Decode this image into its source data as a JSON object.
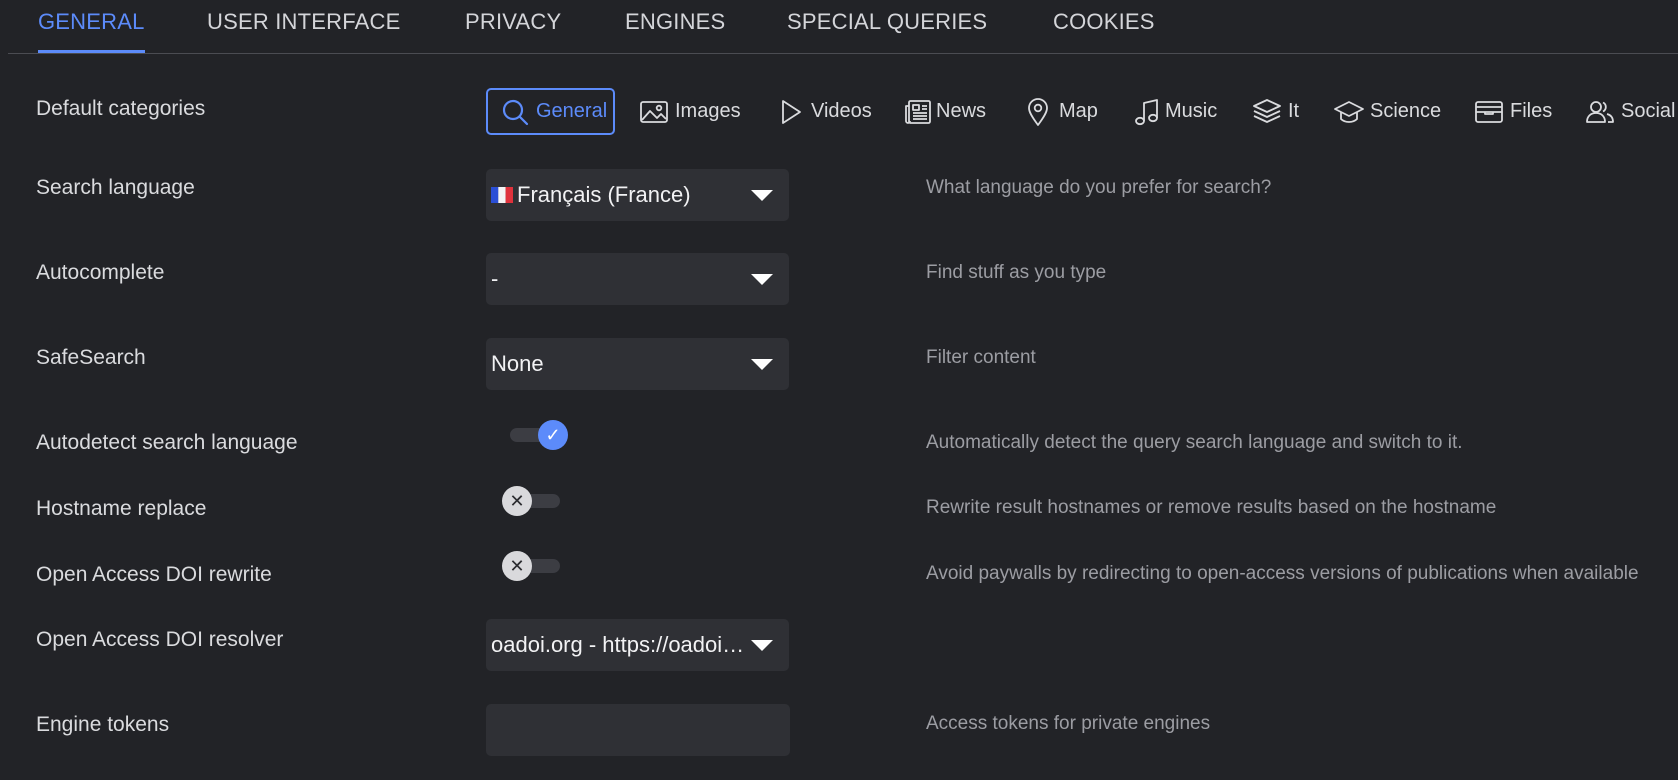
{
  "tabs": [
    {
      "label": "GENERAL",
      "active": true
    },
    {
      "label": "USER INTERFACE",
      "active": false
    },
    {
      "label": "PRIVACY",
      "active": false
    },
    {
      "label": "ENGINES",
      "active": false
    },
    {
      "label": "SPECIAL QUERIES",
      "active": false
    },
    {
      "label": "COOKIES",
      "active": false
    }
  ],
  "default_categories": {
    "label": "Default categories",
    "items": [
      {
        "label": "General",
        "icon": "search-icon",
        "selected": true
      },
      {
        "label": "Images",
        "icon": "image-icon",
        "selected": false
      },
      {
        "label": "Videos",
        "icon": "play-icon",
        "selected": false
      },
      {
        "label": "News",
        "icon": "newspaper-icon",
        "selected": false
      },
      {
        "label": "Map",
        "icon": "map-pin-icon",
        "selected": false
      },
      {
        "label": "Music",
        "icon": "music-note-icon",
        "selected": false
      },
      {
        "label": "It",
        "icon": "layers-icon",
        "selected": false
      },
      {
        "label": "Science",
        "icon": "graduation-cap-icon",
        "selected": false
      },
      {
        "label": "Files",
        "icon": "archive-tray-icon",
        "selected": false
      },
      {
        "label": "Social",
        "icon": "people-icon",
        "selected": false
      }
    ]
  },
  "search_language": {
    "label": "Search language",
    "value": "Français (France)",
    "flag": "french-flag-icon",
    "description": "What language do you prefer for search?"
  },
  "autocomplete": {
    "label": "Autocomplete",
    "value": "-",
    "description": "Find stuff as you type"
  },
  "safesearch": {
    "label": "SafeSearch",
    "value": "None",
    "description": "Filter content"
  },
  "autodetect_language": {
    "label": "Autodetect search language",
    "enabled": true,
    "knob_symbol": "✓",
    "description": "Automatically detect the query search language and switch to it."
  },
  "hostname_replace": {
    "label": "Hostname replace",
    "enabled": false,
    "knob_symbol": "✕",
    "description": "Rewrite result hostnames or remove results based on the hostname"
  },
  "oa_doi_rewrite": {
    "label": "Open Access DOI rewrite",
    "enabled": false,
    "knob_symbol": "✕",
    "description": "Avoid paywalls by redirecting to open-access versions of publications when available"
  },
  "oa_doi_resolver": {
    "label": "Open Access DOI resolver",
    "value": "oadoi.org - https://oadoi.org/"
  },
  "engine_tokens": {
    "label": "Engine tokens",
    "value": "",
    "description": "Access tokens for private engines"
  },
  "colors": {
    "background": "#222327",
    "accent": "#5c8bfa",
    "field": "#2f3035",
    "description_text": "#9c9da3"
  }
}
